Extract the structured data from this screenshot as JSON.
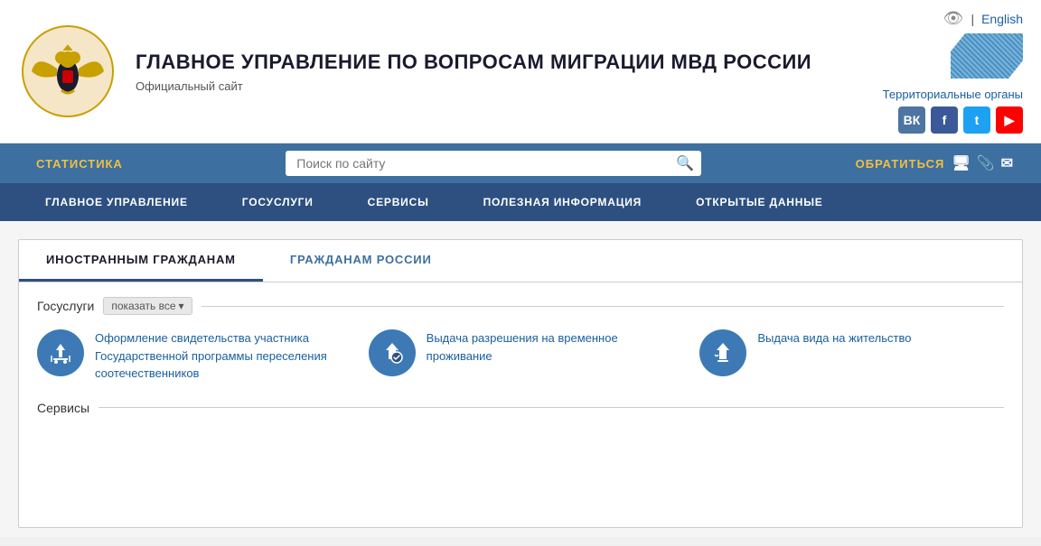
{
  "header": {
    "title": "ГЛАВНОЕ УПРАВЛЕНИЕ ПО ВОПРОСАМ МИГРАЦИИ МВД РОССИИ",
    "subtitle": "Официальный сайт",
    "lang_icon": "👁",
    "lang_separator": "|",
    "lang_label": "English",
    "territorial_label": "Территориальные органы",
    "social": [
      {
        "name": "vk",
        "label": "ВК"
      },
      {
        "name": "facebook",
        "label": "f"
      },
      {
        "name": "twitter",
        "label": "t"
      },
      {
        "name": "youtube",
        "label": "▶"
      }
    ]
  },
  "navbar_top": {
    "stat_label": "СТАТИСТИКА",
    "search_placeholder": "Поиск по сайту",
    "contact_label": "ОБРАТИТЬСЯ",
    "contact_icons": [
      "🖥",
      "📎",
      "✉"
    ]
  },
  "navbar_main": {
    "items": [
      "ГЛАВНОЕ УПРАВЛЕНИЕ",
      "ГОСУСЛУГИ",
      "СЕРВИСЫ",
      "ПОЛЕЗНАЯ ИНФОРМАЦИЯ",
      "ОТКРЫТЫЕ ДАННЫЕ"
    ]
  },
  "tabs": [
    {
      "id": "foreign",
      "label": "ИНОСТРАННЫМ ГРАЖДАНАМ",
      "active": true
    },
    {
      "id": "russian",
      "label": "ГРАЖДАНАМ РОССИИ",
      "active": false
    }
  ],
  "gosuslugi": {
    "section_label": "Госуслуги",
    "show_all_label": "показать все",
    "chevron": "▾",
    "services": [
      {
        "id": "service-1",
        "title": "Оформление свидетельства участника Государственной программы переселения соотечественников"
      },
      {
        "id": "service-2",
        "title": "Выдача разрешения на временное проживание"
      },
      {
        "id": "service-3",
        "title": "Выдача вида на жительство"
      }
    ]
  },
  "serv": {
    "section_label": "Сервисы"
  }
}
